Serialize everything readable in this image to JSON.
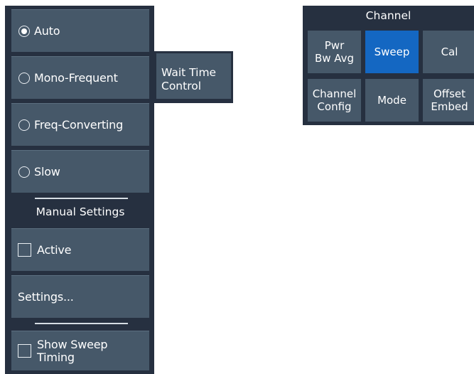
{
  "sweep_type_menu": {
    "options": [
      {
        "label": "Auto",
        "selected": true
      },
      {
        "label": "Mono-Frequent",
        "selected": false
      },
      {
        "label": "Freq-Converting",
        "selected": false
      },
      {
        "label": "Slow",
        "selected": false
      }
    ],
    "manual_settings_header": "Manual Settings",
    "active_label": "Active",
    "settings_label": "Settings...",
    "show_sweep_timing_label": "Show Sweep Timing"
  },
  "context_popup": {
    "label": "Wait Time Control"
  },
  "channel_toolbar": {
    "title": "Channel",
    "buttons": [
      {
        "label": "Pwr\nBw Avg",
        "active": false
      },
      {
        "label": "Sweep",
        "active": true
      },
      {
        "label": "Cal",
        "active": false
      },
      {
        "label": "Channel\nConfig",
        "active": false
      },
      {
        "label": "Mode",
        "active": false
      },
      {
        "label": "Offset\nEmbed",
        "active": false
      }
    ]
  },
  "colors": {
    "panel_bg": "#263040",
    "button_bg": "#465869",
    "active_button_bg": "#1467c2",
    "text": "#ffffff"
  }
}
